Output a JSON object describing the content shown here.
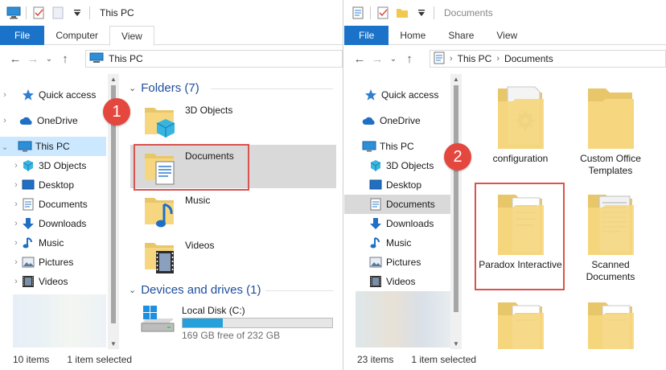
{
  "left": {
    "title": "This PC",
    "tabs": [
      "File",
      "Computer",
      "View"
    ],
    "address": [
      "This PC"
    ],
    "nav": [
      {
        "label": "Quick access",
        "icon": "star-icon"
      },
      {
        "label": "OneDrive",
        "icon": "cloud-icon"
      },
      {
        "label": "This PC",
        "icon": "pc-icon"
      },
      {
        "label": "3D Objects",
        "icon": "cube-icon"
      },
      {
        "label": "Desktop",
        "icon": "desktop-icon"
      },
      {
        "label": "Documents",
        "icon": "document-icon"
      },
      {
        "label": "Downloads",
        "icon": "download-icon"
      },
      {
        "label": "Music",
        "icon": "music-icon"
      },
      {
        "label": "Pictures",
        "icon": "pictures-icon"
      },
      {
        "label": "Videos",
        "icon": "video-icon"
      }
    ],
    "folders_header": "Folders (7)",
    "folders": [
      {
        "label": "3D Objects",
        "icon": "cube-folder-icon"
      },
      {
        "label": "Documents",
        "icon": "documents-folder-icon"
      },
      {
        "label": "Music",
        "icon": "music-folder-icon"
      },
      {
        "label": "Videos",
        "icon": "videos-folder-icon"
      }
    ],
    "drives_header": "Devices and drives (1)",
    "drive": {
      "label": "Local Disk (C:)",
      "free": "169 GB free of 232 GB",
      "used_fraction": 0.27
    },
    "status": {
      "count": "10 items",
      "selected": "1 item selected"
    },
    "badge": "1"
  },
  "right": {
    "title": "Documents",
    "tabs": [
      "File",
      "Home",
      "Share",
      "View"
    ],
    "address": [
      "This PC",
      "Documents"
    ],
    "nav": [
      {
        "label": "Quick access",
        "icon": "star-icon"
      },
      {
        "label": "OneDrive",
        "icon": "cloud-icon"
      },
      {
        "label": "This PC",
        "icon": "pc-icon"
      },
      {
        "label": "3D Objects",
        "icon": "cube-icon"
      },
      {
        "label": "Desktop",
        "icon": "desktop-icon"
      },
      {
        "label": "Documents",
        "icon": "document-icon"
      },
      {
        "label": "Downloads",
        "icon": "download-icon"
      },
      {
        "label": "Music",
        "icon": "music-icon"
      },
      {
        "label": "Pictures",
        "icon": "pictures-icon"
      },
      {
        "label": "Videos",
        "icon": "video-icon"
      }
    ],
    "items": [
      {
        "label": "configuration",
        "icon": "settings-folder-icon"
      },
      {
        "label": "Custom Office Templates",
        "icon": "folder-icon"
      },
      {
        "label": "Paradox Interactive",
        "icon": "paper-folder-icon"
      },
      {
        "label": "Scanned Documents",
        "icon": "scanned-folder-icon"
      }
    ],
    "status": {
      "count": "23 items",
      "selected": "1 item selected"
    },
    "badge": "2"
  }
}
